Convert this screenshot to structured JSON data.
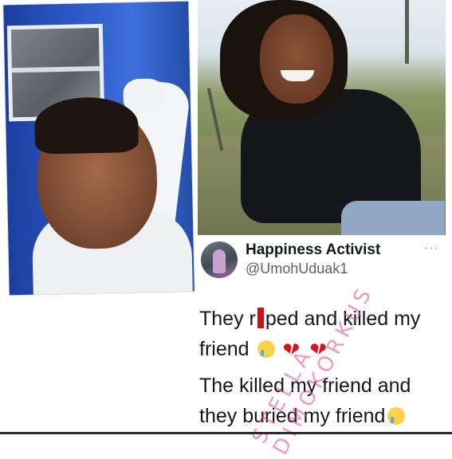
{
  "left_photo": {
    "alt": "crying woman video still"
  },
  "right_photo": {
    "alt": "smiling woman outdoor photo"
  },
  "tweet": {
    "display_name": "Happiness Activist",
    "handle": "@UmohUduak1",
    "more_label": "···",
    "line1_a": "They r",
    "line1_b": "ped and killed my friend",
    "line2": "The killed my friend and they buried my friend",
    "watermark": "STELLA DIMOKORKUS"
  },
  "icons": {
    "avatar": "avatar-photo",
    "crying": "loudly-crying-face-icon",
    "broken_heart": "broken-heart-icon"
  },
  "colors": {
    "text": "#14171a",
    "handle": "#56626d",
    "censor": "#c21818",
    "watermark": "#e2468c"
  }
}
